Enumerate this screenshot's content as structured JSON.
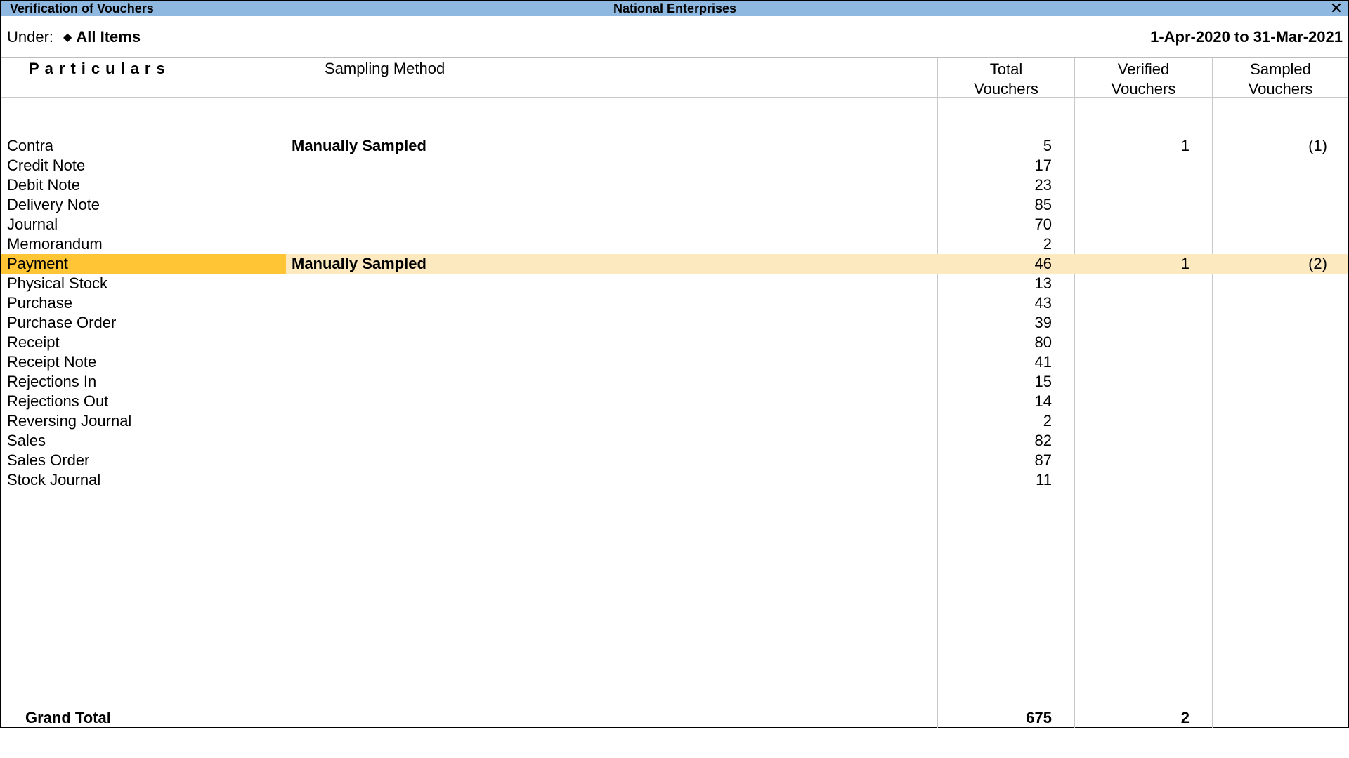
{
  "window": {
    "title": "Verification of Vouchers",
    "company": "National Enterprises",
    "close_icon": "close-icon"
  },
  "filter": {
    "under_label": "Under:",
    "under_icon": "diamond-icon",
    "under_value": "All Items",
    "period": "1-Apr-2020 to 31-Mar-2021"
  },
  "columns": {
    "particulars": "Particulars",
    "sampling_method": "Sampling Method",
    "total_line1": "Total",
    "total_line2": "Vouchers",
    "verified_line1": "Verified",
    "verified_line2": "Vouchers",
    "sampled_line1": "Sampled",
    "sampled_line2": "Vouchers"
  },
  "rows": [
    {
      "particulars": "Contra",
      "sampling": "Manually Sampled",
      "total": "5",
      "verified": "1",
      "sampled": "(1)"
    },
    {
      "particulars": "Credit Note",
      "sampling": "",
      "total": "17",
      "verified": "",
      "sampled": ""
    },
    {
      "particulars": "Debit Note",
      "sampling": "",
      "total": "23",
      "verified": "",
      "sampled": ""
    },
    {
      "particulars": "Delivery Note",
      "sampling": "",
      "total": "85",
      "verified": "",
      "sampled": ""
    },
    {
      "particulars": "Journal",
      "sampling": "",
      "total": "70",
      "verified": "",
      "sampled": ""
    },
    {
      "particulars": "Memorandum",
      "sampling": "",
      "total": "2",
      "verified": "",
      "sampled": ""
    },
    {
      "particulars": "Payment",
      "sampling": "Manually Sampled",
      "total": "46",
      "verified": "1",
      "sampled": "(2)",
      "selected": true
    },
    {
      "particulars": "Physical Stock",
      "sampling": "",
      "total": "13",
      "verified": "",
      "sampled": ""
    },
    {
      "particulars": "Purchase",
      "sampling": "",
      "total": "43",
      "verified": "",
      "sampled": ""
    },
    {
      "particulars": "Purchase Order",
      "sampling": "",
      "total": "39",
      "verified": "",
      "sampled": ""
    },
    {
      "particulars": "Receipt",
      "sampling": "",
      "total": "80",
      "verified": "",
      "sampled": ""
    },
    {
      "particulars": "Receipt Note",
      "sampling": "",
      "total": "41",
      "verified": "",
      "sampled": ""
    },
    {
      "particulars": "Rejections In",
      "sampling": "",
      "total": "15",
      "verified": "",
      "sampled": ""
    },
    {
      "particulars": "Rejections Out",
      "sampling": "",
      "total": "14",
      "verified": "",
      "sampled": ""
    },
    {
      "particulars": "Reversing Journal",
      "sampling": "",
      "total": "2",
      "verified": "",
      "sampled": ""
    },
    {
      "particulars": "Sales",
      "sampling": "",
      "total": "82",
      "verified": "",
      "sampled": ""
    },
    {
      "particulars": "Sales Order",
      "sampling": "",
      "total": "87",
      "verified": "",
      "sampled": ""
    },
    {
      "particulars": "Stock Journal",
      "sampling": "",
      "total": "11",
      "verified": "",
      "sampled": ""
    }
  ],
  "grand_total": {
    "label": "Grand Total",
    "total": "675",
    "verified": "2"
  },
  "colors": {
    "titlebar": "#8fb8e0",
    "selected_row": "#fde9c0",
    "selected_cell": "#ffc534"
  }
}
